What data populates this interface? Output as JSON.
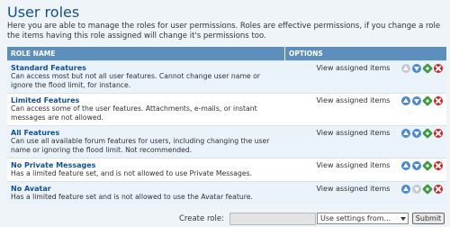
{
  "header": {
    "title": "User roles",
    "intro": "Here you are able to manage the roles for user permissions. Roles are effective permissions, if you change a role the items having this role assigned will change it's permissions too."
  },
  "table": {
    "col_role_name": "ROLE NAME",
    "col_options": "OPTIONS",
    "rows": [
      {
        "name": "Standard Features",
        "desc": "Can access most but not all user features. Cannot change user name or ignore the flood limit, for instance.",
        "view_label": "View assigned items",
        "up_enabled": false,
        "down_enabled": true
      },
      {
        "name": "Limited Features",
        "desc": "Can access some of the user features. Attachments, e-mails, or instant messages are not allowed.",
        "view_label": "View assigned items",
        "up_enabled": true,
        "down_enabled": true
      },
      {
        "name": "All Features",
        "desc": "Can use all available forum features for users, including changing the user name or ignoring the flood limit. Not recommended.",
        "view_label": "View assigned items",
        "up_enabled": true,
        "down_enabled": true
      },
      {
        "name": "No Private Messages",
        "desc": "Has a limited feature set, and is not allowed to use Private Messages.",
        "view_label": "View assigned items",
        "up_enabled": true,
        "down_enabled": true
      },
      {
        "name": "No Avatar",
        "desc": "Has a limited feature set and is not allowed to use the Avatar feature.",
        "view_label": "View assigned items",
        "up_enabled": true,
        "down_enabled": false
      }
    ]
  },
  "create": {
    "label": "Create role:",
    "input_value": "",
    "select_value": "Use settings from...",
    "submit_label": "Submit"
  },
  "colors": {
    "title": "#115098",
    "header_bg": "#5d8fbd",
    "arrow": "#4a8ad0",
    "settings": "#3d9b3d",
    "delete": "#d02020"
  }
}
